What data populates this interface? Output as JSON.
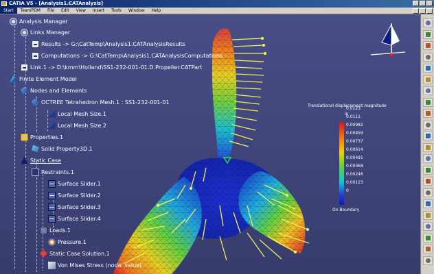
{
  "window": {
    "title": "CATIA V5 - [Analysis1.CATAnalysis]"
  },
  "menu": {
    "items": [
      "Start",
      "TeamPDM",
      "File",
      "Edit",
      "View",
      "Insert",
      "Tools",
      "Window",
      "Help"
    ],
    "active_index": 0
  },
  "tree": {
    "root": "Analysis Manager",
    "links_manager": "Links Manager",
    "results_link": "Results -> G:\\CatTemp\\Analysis1.CATAnalysisResults",
    "computations_link": "Computations -> G:\\CatTemp\\Analysis1.CATAnalysisComputations",
    "part_link": "Link.1 -> D:\\kmm\\Holland\\SS1-232-001-01.D.Propeller.CATPart",
    "fem": "Finite Element Model",
    "nodes_elements": "Nodes and Elements",
    "octree_mesh": "OCTREE Tetrahedron Mesh.1 : SS1-232-001-01",
    "local_mesh_1": "Local Mesh Size.1",
    "local_mesh_2": "Local Mesh Size.2",
    "properties": "Properties.1",
    "solid_property": "Solid Property3D.1",
    "static_case": "Static Case",
    "restraints": "Restraints.1",
    "sliders": [
      "Surface Slider.1",
      "Surface Slider.2",
      "Surface Slider.3",
      "Surface Slider.4"
    ],
    "loads": "Loads.1",
    "pressure": "Pressure.1",
    "solution": "Static Case Solution.1",
    "von_mises": "Von Mises Stress (nodal value)"
  },
  "legend": {
    "title": "Translational displacement magnitude",
    "unit": "in",
    "values": [
      "0.0123",
      "0.0111",
      "0.00982",
      "0.00859",
      "0.00737",
      "0.00614",
      "0.00491",
      "0.00368",
      "0.00246",
      "0.00123",
      "0"
    ],
    "footer": "On Boundary",
    "colors": [
      "#d81818",
      "#f07010",
      "#f0d000",
      "#60d040",
      "#10c8d0",
      "#2040e0",
      "#0c18b0"
    ]
  },
  "colors": {
    "viewport_bg": "#3f4479",
    "title_bar": "#0a246a",
    "arrow": "#f2ef5a",
    "tree_text": "#ffffff"
  },
  "toolbar_icons": [
    "zoom-icon",
    "pan-icon",
    "rotate-icon",
    "fit-icon",
    "normal-view-icon",
    "shading-icon",
    "hide-show-icon",
    "swap-icon",
    "compute-icon",
    "image-icon",
    "animate-icon",
    "cut-plane-icon",
    "amplification-icon",
    "extrema-icon",
    "information-icon",
    "report-icon",
    "sensor-icon",
    "generate-icon",
    "measure-icon",
    "options-icon",
    "analysis-icon",
    "tools-icon"
  ]
}
